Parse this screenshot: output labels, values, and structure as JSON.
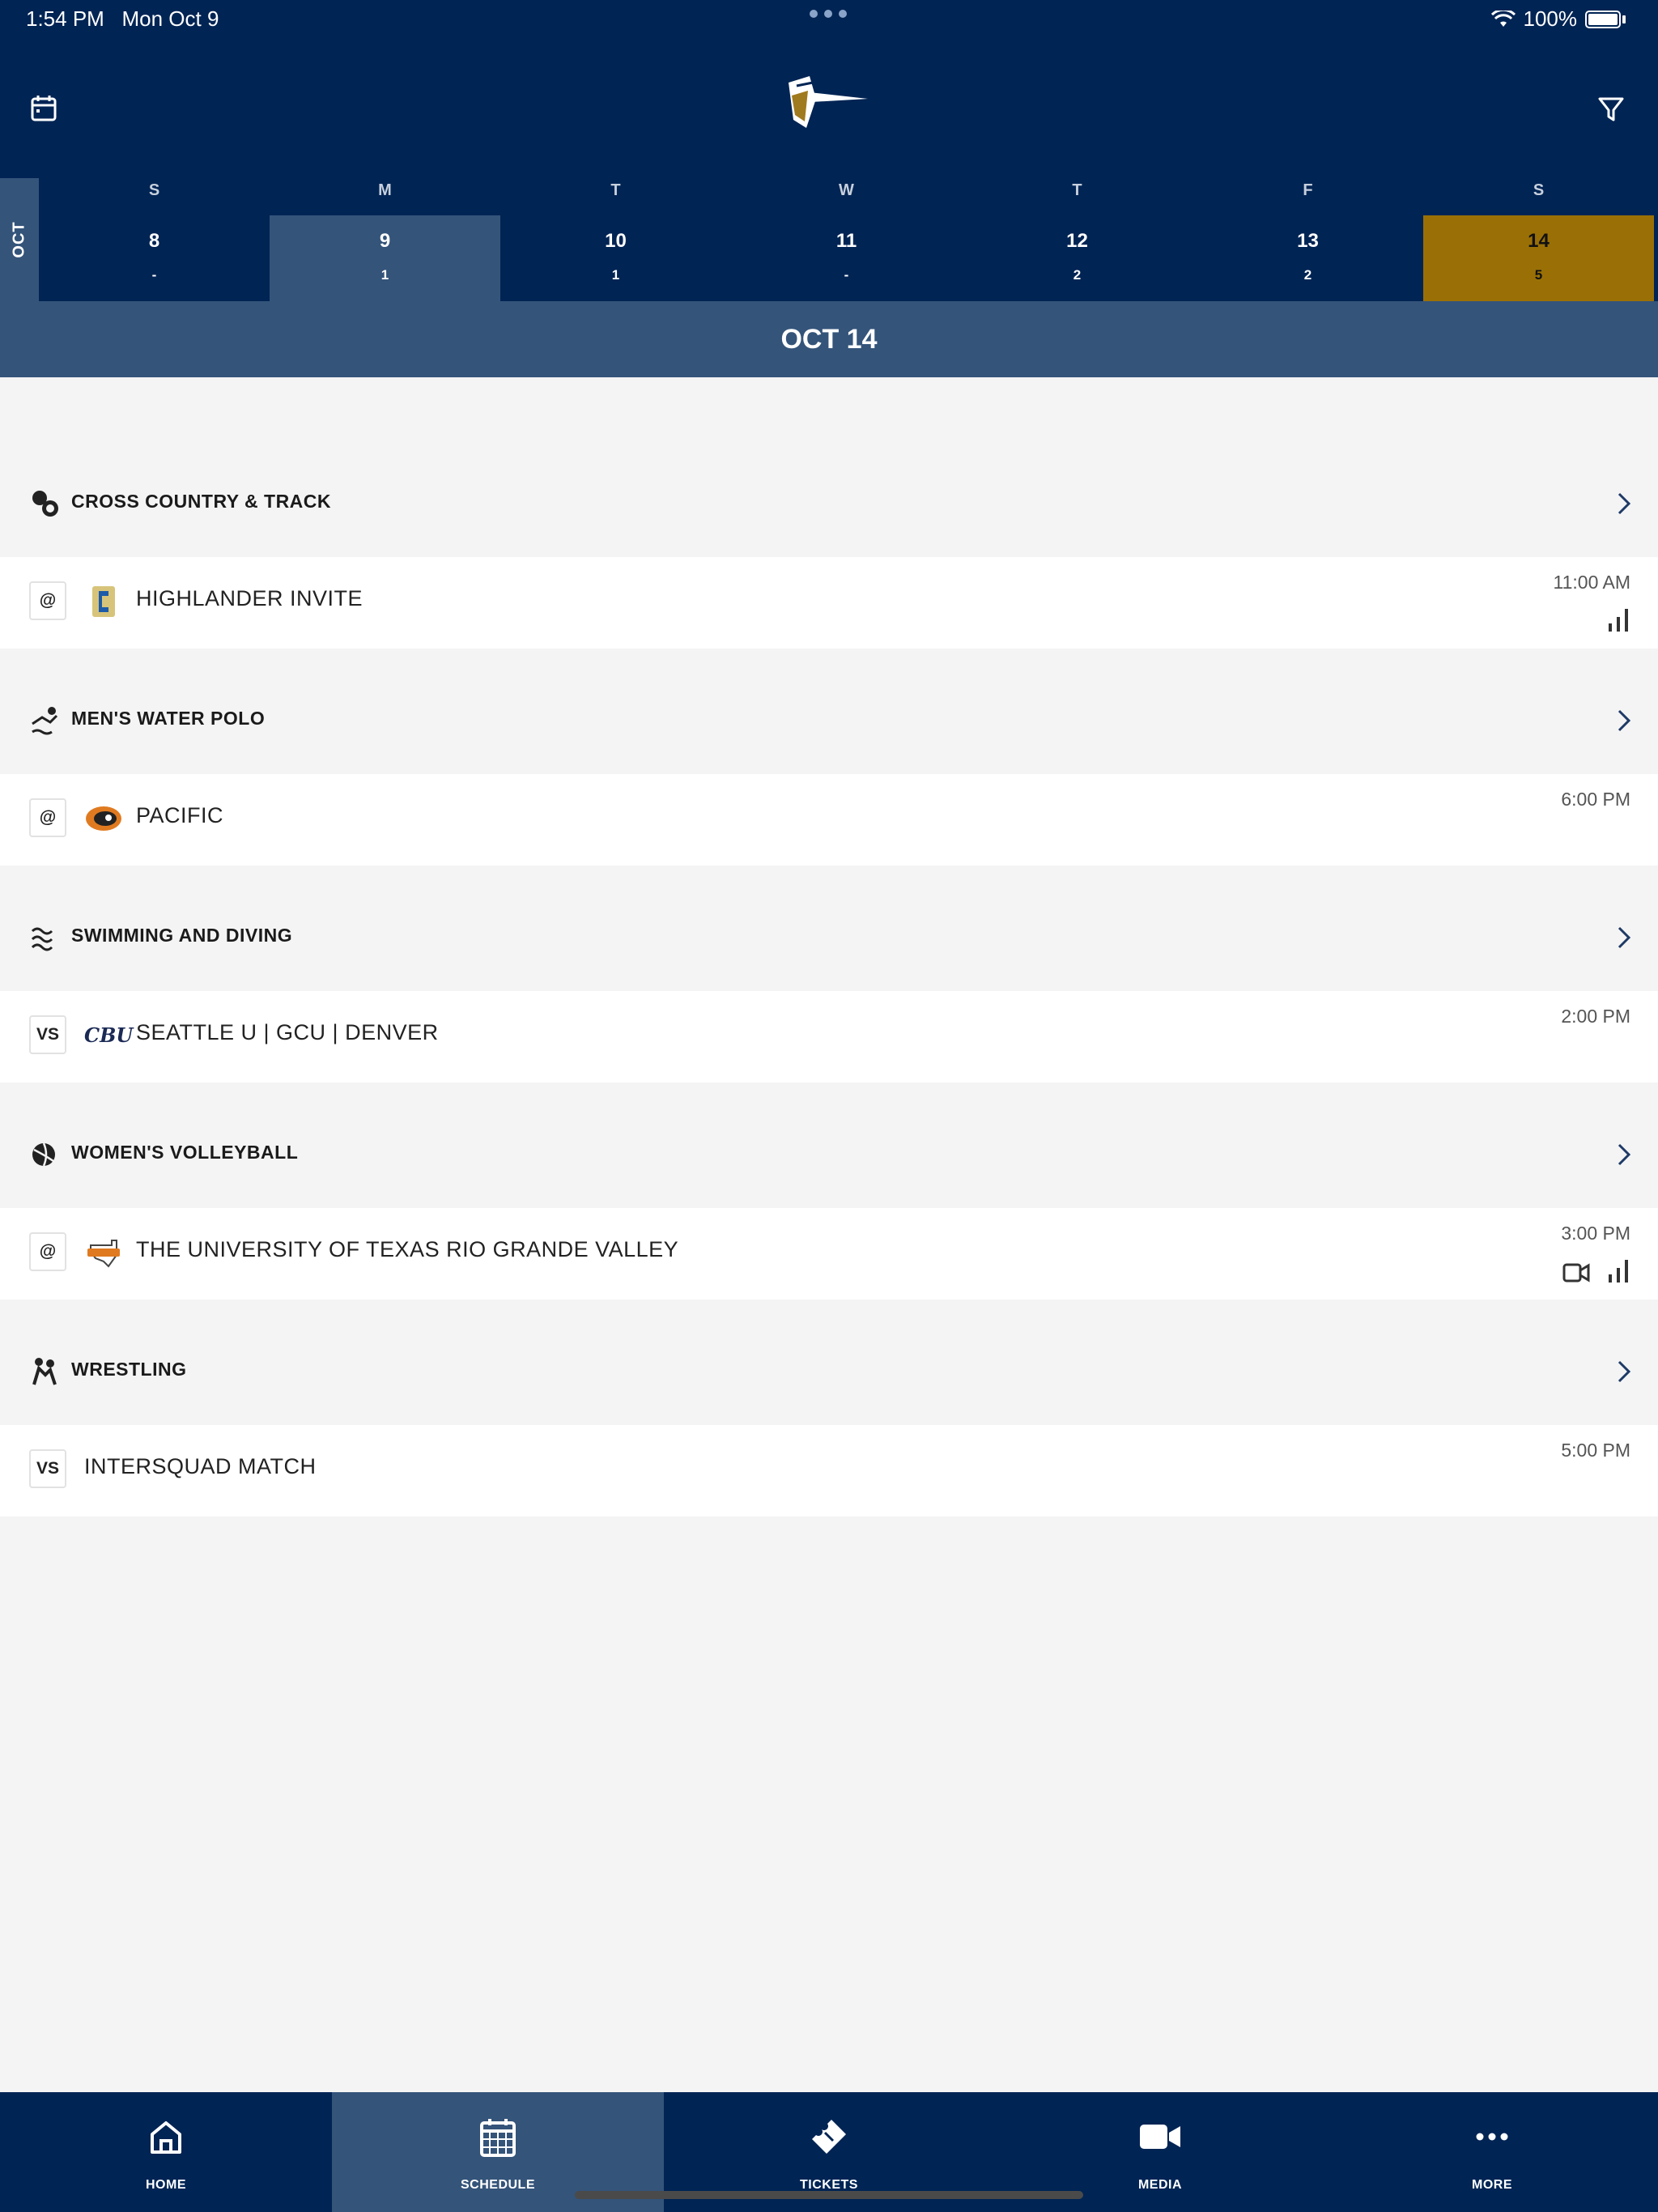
{
  "status_bar": {
    "time": "1:54 PM",
    "date": "Mon Oct 9",
    "battery": "100%"
  },
  "header": {
    "calendar_icon": "calendar-icon",
    "filter_icon": "filter-icon",
    "logo": "lancer-logo"
  },
  "week": {
    "month": "OCT",
    "days": [
      {
        "letter": "S",
        "num": "8",
        "count": "-"
      },
      {
        "letter": "M",
        "num": "9",
        "count": "1"
      },
      {
        "letter": "T",
        "num": "10",
        "count": "1"
      },
      {
        "letter": "W",
        "num": "11",
        "count": "-"
      },
      {
        "letter": "T",
        "num": "12",
        "count": "2"
      },
      {
        "letter": "F",
        "num": "13",
        "count": "2"
      },
      {
        "letter": "S",
        "num": "14",
        "count": "5"
      }
    ],
    "selected_index": 6,
    "today_index": 1
  },
  "selected_date": "OCT 14",
  "sections": [
    {
      "sport": "CROSS COUNTRY & TRACK",
      "icon": "cross-country-icon",
      "event": {
        "loc": "@",
        "name": "HIGHLANDER INVITE",
        "time": "11:00 AM",
        "logo": "highlander-logo",
        "stats": true,
        "video": false
      }
    },
    {
      "sport": "MEN'S WATER POLO",
      "icon": "water-polo-icon",
      "event": {
        "loc": "@",
        "name": "PACIFIC",
        "time": "6:00 PM",
        "logo": "pacific-logo",
        "stats": false,
        "video": false
      }
    },
    {
      "sport": "SWIMMING AND DIVING",
      "icon": "swimming-icon",
      "event": {
        "loc": "VS",
        "name": "SEATTLE U | GCU | DENVER",
        "time": "2:00 PM",
        "logo_text": "CBU",
        "stats": false,
        "video": false
      }
    },
    {
      "sport": "WOMEN'S VOLLEYBALL",
      "icon": "volleyball-icon",
      "event": {
        "loc": "@",
        "name": "THE UNIVERSITY OF TEXAS RIO GRANDE VALLEY",
        "time": "3:00 PM",
        "logo": "utrgv-logo",
        "stats": true,
        "video": true
      }
    },
    {
      "sport": "WRESTLING",
      "icon": "wrestling-icon",
      "event": {
        "loc": "VS",
        "name": "INTERSQUAD MATCH",
        "time": "5:00 PM",
        "stats": false,
        "video": false
      }
    }
  ],
  "tabs": [
    {
      "label": "HOME",
      "icon": "home-icon"
    },
    {
      "label": "SCHEDULE",
      "icon": "calendar-icon"
    },
    {
      "label": "TICKETS",
      "icon": "ticket-icon"
    },
    {
      "label": "MEDIA",
      "icon": "video-camera-icon"
    },
    {
      "label": "MORE",
      "icon": "more-dots-icon"
    }
  ],
  "colors": {
    "navy": "#002454",
    "slate": "#34547a",
    "gold": "#9a7006",
    "background": "#f4f4f4"
  }
}
